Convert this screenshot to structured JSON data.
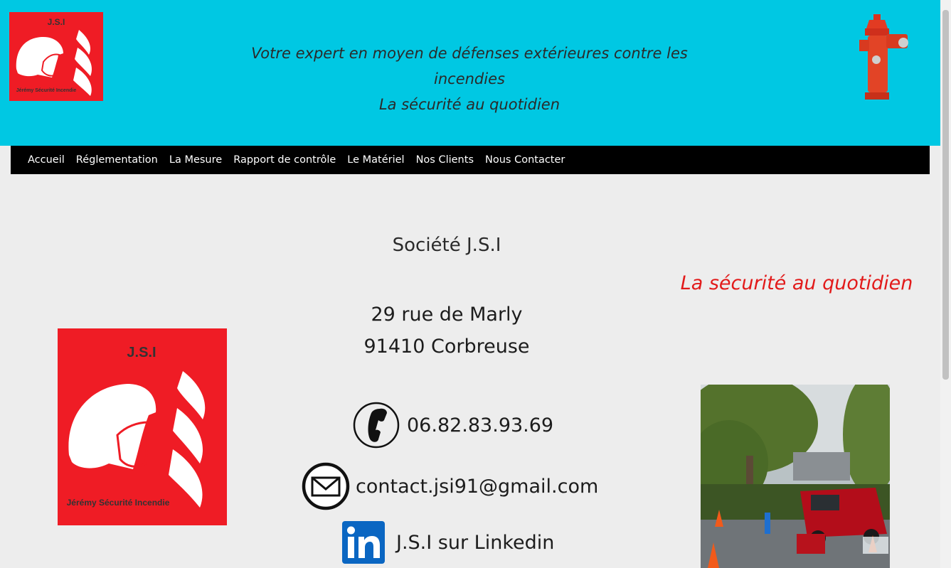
{
  "header": {
    "logo_title": "J.S.I",
    "logo_subtitle": "Jérémy Sécurité Incendie",
    "tagline_line1": "Votre expert en moyen de défenses extérieures contre les incendies",
    "tagline_line2": "La sécurité au quotidien"
  },
  "nav": {
    "items": [
      "Accueil",
      "Réglementation",
      "La Mesure",
      "Rapport de contrôle",
      "Le Matériel",
      "Nos Clients",
      "Nous Contacter"
    ]
  },
  "main": {
    "company_name": "Société J.S.I",
    "address_line1": "29 rue de Marly",
    "address_line2": "91410 Corbreuse",
    "slogan": "La sécurité au quotidien",
    "phone": "06.82.83.93.69",
    "email": "contact.jsi91@gmail.com",
    "linkedin": "J.S.I sur Linkedin",
    "logo_title": "J.S.I",
    "logo_subtitle": "Jérémy Sécurité Incendie"
  },
  "colors": {
    "header_bg": "#00c8e3",
    "nav_bg": "#000000",
    "brand_red": "#ef1c25",
    "slogan_red": "#e21a1a",
    "linkedin_blue": "#0a66c2"
  },
  "icons": {
    "phone": "phone-icon",
    "mail": "mail-icon",
    "linkedin": "linkedin-icon"
  }
}
